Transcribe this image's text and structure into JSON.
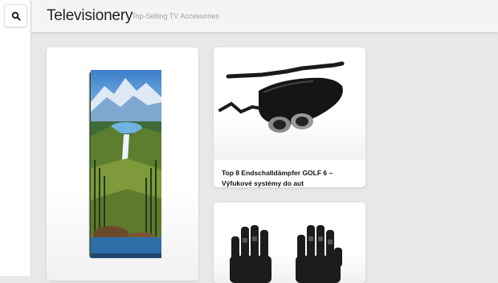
{
  "site": {
    "title": "Televisionery",
    "tagline": "Top-Selling TV Accessories"
  },
  "sidebar": {
    "search_icon": "search-icon"
  },
  "products": [
    {
      "title": "",
      "image": "towel-mountain-waterfall-image"
    },
    {
      "title": "Top 8 Endschalldämpfer GOLF 6 – Výfukové systémy do aut",
      "image": "exhaust-muffler-image"
    },
    {
      "title": "",
      "image": "gloves-image"
    }
  ]
}
